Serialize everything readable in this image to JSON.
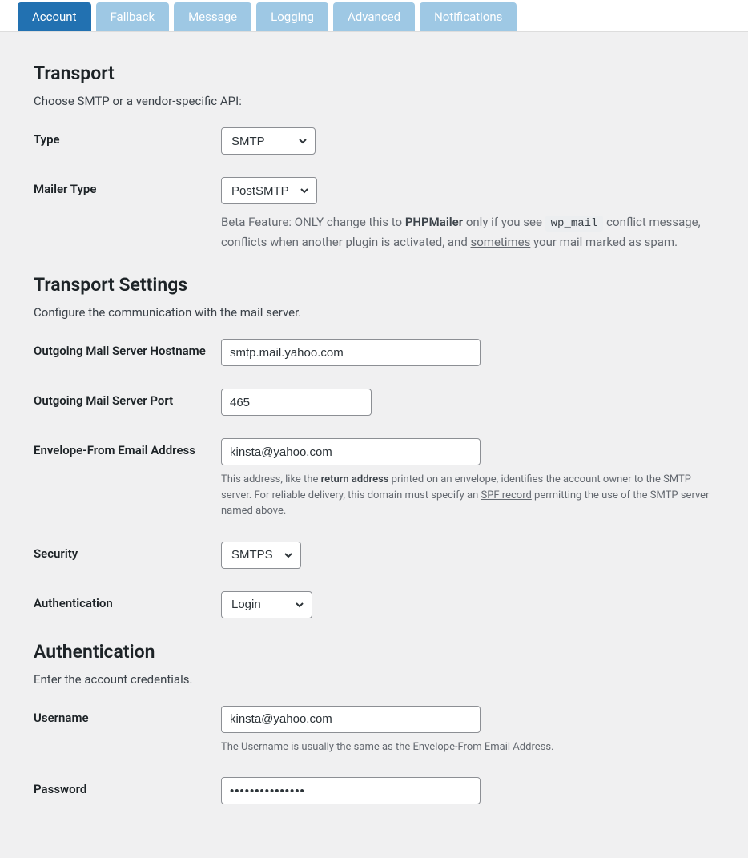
{
  "tabs": [
    {
      "label": "Account",
      "active": true
    },
    {
      "label": "Fallback",
      "active": false
    },
    {
      "label": "Message",
      "active": false
    },
    {
      "label": "Logging",
      "active": false
    },
    {
      "label": "Advanced",
      "active": false
    },
    {
      "label": "Notifications",
      "active": false
    }
  ],
  "transport": {
    "heading": "Transport",
    "sub": "Choose SMTP or a vendor-specific API:",
    "type": {
      "label": "Type",
      "value": "SMTP"
    },
    "mailer_type": {
      "label": "Mailer Type",
      "value": "PostSMTP",
      "help_pre": "Beta Feature: ONLY change this to ",
      "help_strong": "PHPMailer",
      "help_mid": " only if you see ",
      "help_code": "wp_mail",
      "help_post1": " conflict message, conflicts when another plugin is activated, and ",
      "help_link": "sometimes",
      "help_post2": " your mail marked as spam."
    }
  },
  "transport_settings": {
    "heading": "Transport Settings",
    "sub": "Configure the communication with the mail server.",
    "hostname": {
      "label": "Outgoing Mail Server Hostname",
      "value": "smtp.mail.yahoo.com"
    },
    "port": {
      "label": "Outgoing Mail Server Port",
      "value": "465"
    },
    "envelope": {
      "label": "Envelope-From Email Address",
      "value": "kinsta@yahoo.com",
      "help_pre": "This address, like the ",
      "help_strong": "return address",
      "help_mid": " printed on an envelope, identifies the account owner to the SMTP server. For reliable delivery, this domain must specify an ",
      "help_link": "SPF record",
      "help_post": " permitting the use of the SMTP server named above."
    },
    "security": {
      "label": "Security",
      "value": "SMTPS"
    },
    "authentication": {
      "label": "Authentication",
      "value": "Login"
    }
  },
  "auth": {
    "heading": "Authentication",
    "sub": "Enter the account credentials.",
    "username": {
      "label": "Username",
      "value": "kinsta@yahoo.com",
      "help": "The Username is usually the same as the Envelope-From Email Address."
    },
    "password": {
      "label": "Password",
      "value": "•••••••••••••••"
    }
  }
}
